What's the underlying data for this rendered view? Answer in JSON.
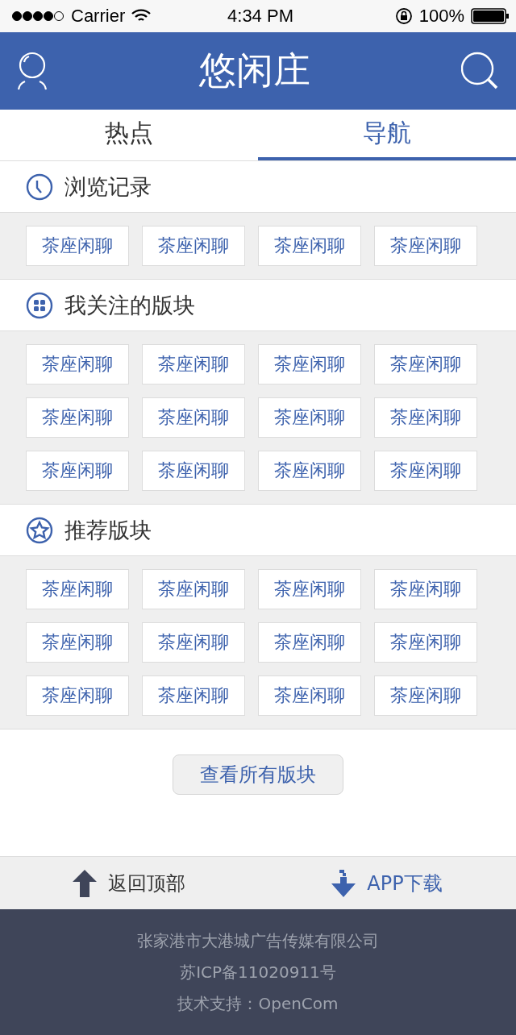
{
  "status_bar": {
    "carrier": "Carrier",
    "time": "4:34 PM",
    "battery": "100%"
  },
  "header": {
    "title": "悠闲庄"
  },
  "tabs": [
    {
      "label": "热点",
      "selected": false
    },
    {
      "label": "导航",
      "selected": true
    }
  ],
  "sections": [
    {
      "kind": "history",
      "title": "浏览记录",
      "items": [
        "茶座闲聊",
        "茶座闲聊",
        "茶座闲聊",
        "茶座闲聊"
      ]
    },
    {
      "kind": "following",
      "title": "我关注的版块",
      "items": [
        "茶座闲聊",
        "茶座闲聊",
        "茶座闲聊",
        "茶座闲聊",
        "茶座闲聊",
        "茶座闲聊",
        "茶座闲聊",
        "茶座闲聊",
        "茶座闲聊",
        "茶座闲聊",
        "茶座闲聊",
        "茶座闲聊"
      ]
    },
    {
      "kind": "recommended",
      "title": "推荐版块",
      "items": [
        "茶座闲聊",
        "茶座闲聊",
        "茶座闲聊",
        "茶座闲聊",
        "茶座闲聊",
        "茶座闲聊",
        "茶座闲聊",
        "茶座闲聊",
        "茶座闲聊",
        "茶座闲聊",
        "茶座闲聊",
        "茶座闲聊"
      ]
    }
  ],
  "view_all_button": "查看所有版块",
  "bottom_bar": [
    {
      "kind": "top",
      "label": "返回顶部"
    },
    {
      "kind": "download",
      "label": "APP下载"
    }
  ],
  "footer": [
    "张家港市大港城广告传媒有限公司",
    "苏ICP备11020911号",
    "技术支持：OpenCom"
  ]
}
